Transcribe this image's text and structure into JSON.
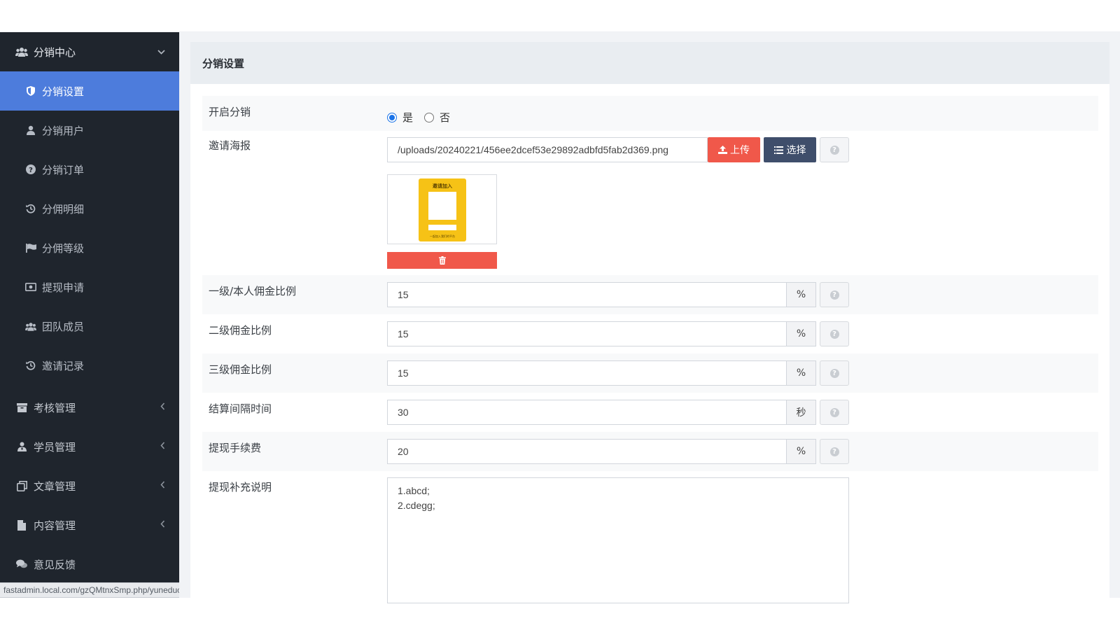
{
  "sidebar": {
    "group": {
      "label": "分销中心",
      "icon": "users-icon"
    },
    "items": [
      {
        "label": "分销设置",
        "icon": "shield-icon",
        "active": true
      },
      {
        "label": "分销用户",
        "icon": "user-icon"
      },
      {
        "label": "分销订单",
        "icon": "question-circle-icon"
      },
      {
        "label": "分佣明细",
        "icon": "history-icon"
      },
      {
        "label": "分佣等级",
        "icon": "flag-icon"
      },
      {
        "label": "提现申请",
        "icon": "money-icon"
      },
      {
        "label": "团队成员",
        "icon": "users-icon"
      },
      {
        "label": "邀请记录",
        "icon": "history-icon"
      }
    ],
    "sections": [
      {
        "label": "考核管理",
        "icon": "archive-icon"
      },
      {
        "label": "学员管理",
        "icon": "student-icon"
      },
      {
        "label": "文章管理",
        "icon": "copy-icon"
      },
      {
        "label": "内容管理",
        "icon": "file-icon"
      },
      {
        "label": "意见反馈",
        "icon": "comments-icon"
      }
    ]
  },
  "statusbar": {
    "url": "fastadmin.local.com/gzQMtnxSmp.php/yuneducation/distribute/config?ref=addta..."
  },
  "panel": {
    "title": "分销设置"
  },
  "form": {
    "enable": {
      "label": "开启分销",
      "options": [
        "是",
        "否"
      ],
      "selected": "是"
    },
    "poster": {
      "label": "邀请海报",
      "value": "/uploads/20240221/456ee2dcef53e29892adbfd5fab2d369.png",
      "upload_label": "上传",
      "select_label": "选择",
      "preview_title": "邀请加入",
      "preview_footer": "一起加入我们的平台"
    },
    "level1": {
      "label": "一级/本人佣金比例",
      "value": "15",
      "unit": "%"
    },
    "level2": {
      "label": "二级佣金比例",
      "value": "15",
      "unit": "%"
    },
    "level3": {
      "label": "三级佣金比例",
      "value": "15",
      "unit": "%"
    },
    "interval": {
      "label": "结算间隔时间",
      "value": "30",
      "unit": "秒"
    },
    "fee": {
      "label": "提现手续费",
      "value": "20",
      "unit": "%"
    },
    "remark": {
      "label": "提现补充说明",
      "value": "1.abcd;\n2.cdegg;"
    }
  },
  "colors": {
    "sidebar_bg": "#1f252d",
    "active": "#4d7cdc",
    "danger": "#f0584a",
    "navy": "#3f4e6b"
  }
}
